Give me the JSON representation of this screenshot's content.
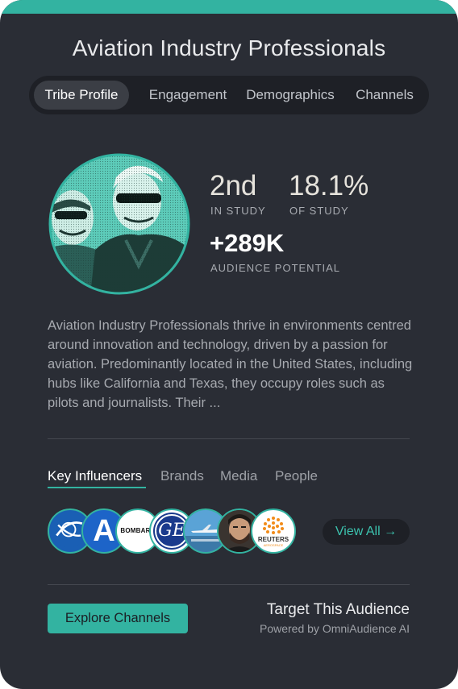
{
  "header": {
    "title": "Aviation Industry Professionals",
    "accent_color": "#33b3a1",
    "background_color": "#2a2d35"
  },
  "tabs": [
    {
      "label": "Tribe Profile",
      "active": true
    },
    {
      "label": "Engagement",
      "active": false
    },
    {
      "label": "Demographics",
      "active": false
    },
    {
      "label": "Channels",
      "active": false
    }
  ],
  "profile": {
    "avatar_icon": "tribe-photo-icon",
    "stats": {
      "rank_value": "2nd",
      "rank_label": "IN STUDY",
      "share_value": "18.1%",
      "share_label": "OF STUDY",
      "potential_value": "+289K",
      "potential_label": "AUDIENCE POTENTIAL"
    }
  },
  "description": "Aviation Industry Professionals thrive in environments centred around innovation and technology, driven by a passion for aviation. Predominantly located in the United States, including hubs like California and Texas, they occupy roles such as pilots and journalists. Their ...",
  "influencer_tabs": [
    {
      "label": "Key Influencers",
      "active": true
    },
    {
      "label": "Brands",
      "active": false
    },
    {
      "label": "Media",
      "active": false
    },
    {
      "label": "People",
      "active": false
    }
  ],
  "influencers": [
    {
      "icon": "boeing-logo-icon"
    },
    {
      "icon": "airbus-a-logo-icon",
      "text": "A"
    },
    {
      "icon": "bombardier-logo-icon",
      "text": "BOMBARD"
    },
    {
      "icon": "ge-logo-icon",
      "text": "GE"
    },
    {
      "icon": "airplane-photo-icon"
    },
    {
      "icon": "person-portrait-icon"
    },
    {
      "icon": "reuters-logo-icon",
      "text": "REUTERS",
      "subtext": "AEROSPACE"
    }
  ],
  "view_all_label": "View All →",
  "footer": {
    "button_label": "Explore Channels",
    "title": "Target This Audience",
    "subtitle": "Powered by OmniAudience AI"
  }
}
